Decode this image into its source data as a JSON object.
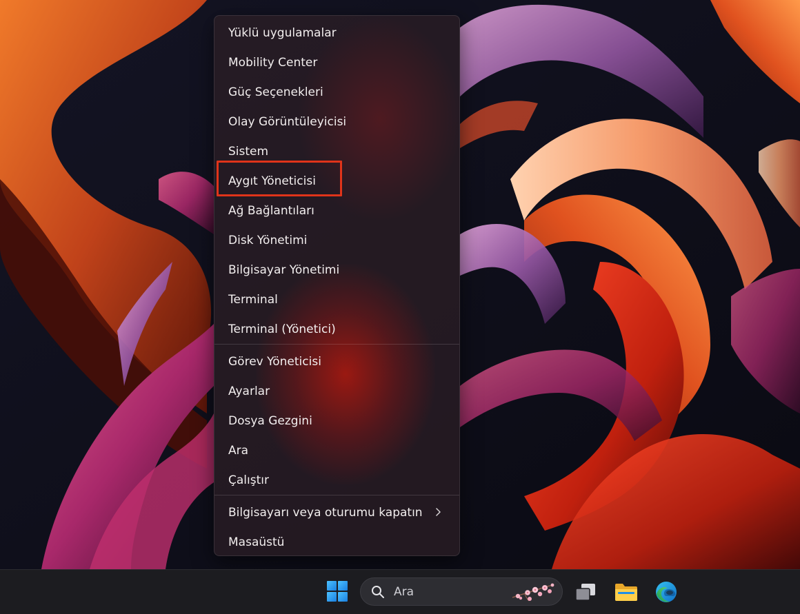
{
  "menu": {
    "items": [
      {
        "label": "Yüklü uygulamalar"
      },
      {
        "label": "Mobility Center"
      },
      {
        "label": "Güç Seçenekleri"
      },
      {
        "label": "Olay Görüntüleyicisi"
      },
      {
        "label": "Sistem"
      },
      {
        "label": "Aygıt Yöneticisi"
      },
      {
        "label": "Ağ Bağlantıları"
      },
      {
        "label": "Disk Yönetimi"
      },
      {
        "label": "Bilgisayar Yönetimi"
      },
      {
        "label": "Terminal"
      },
      {
        "label": "Terminal (Yönetici)"
      },
      {
        "label": "Görev Yöneticisi"
      },
      {
        "label": "Ayarlar"
      },
      {
        "label": "Dosya Gezgini"
      },
      {
        "label": "Ara"
      },
      {
        "label": "Çalıştır"
      },
      {
        "label": "Bilgisayarı veya oturumu kapatın",
        "submenu_icon": "chevron-right-icon"
      },
      {
        "label": "Masaüstü"
      }
    ],
    "highlighted_item": "Aygıt Yöneticisi",
    "highlight_color": "#e0341a"
  },
  "taskbar": {
    "start_icon": "windows-logo-icon",
    "search": {
      "placeholder": "Ara",
      "icon": "search-icon",
      "highlight_icon": "cherry-blossom-icon"
    },
    "pinned": [
      {
        "icon": "task-view-icon"
      },
      {
        "icon": "file-explorer-icon"
      },
      {
        "icon": "edge-icon"
      }
    ],
    "accent_color": "#1f8fe8"
  }
}
